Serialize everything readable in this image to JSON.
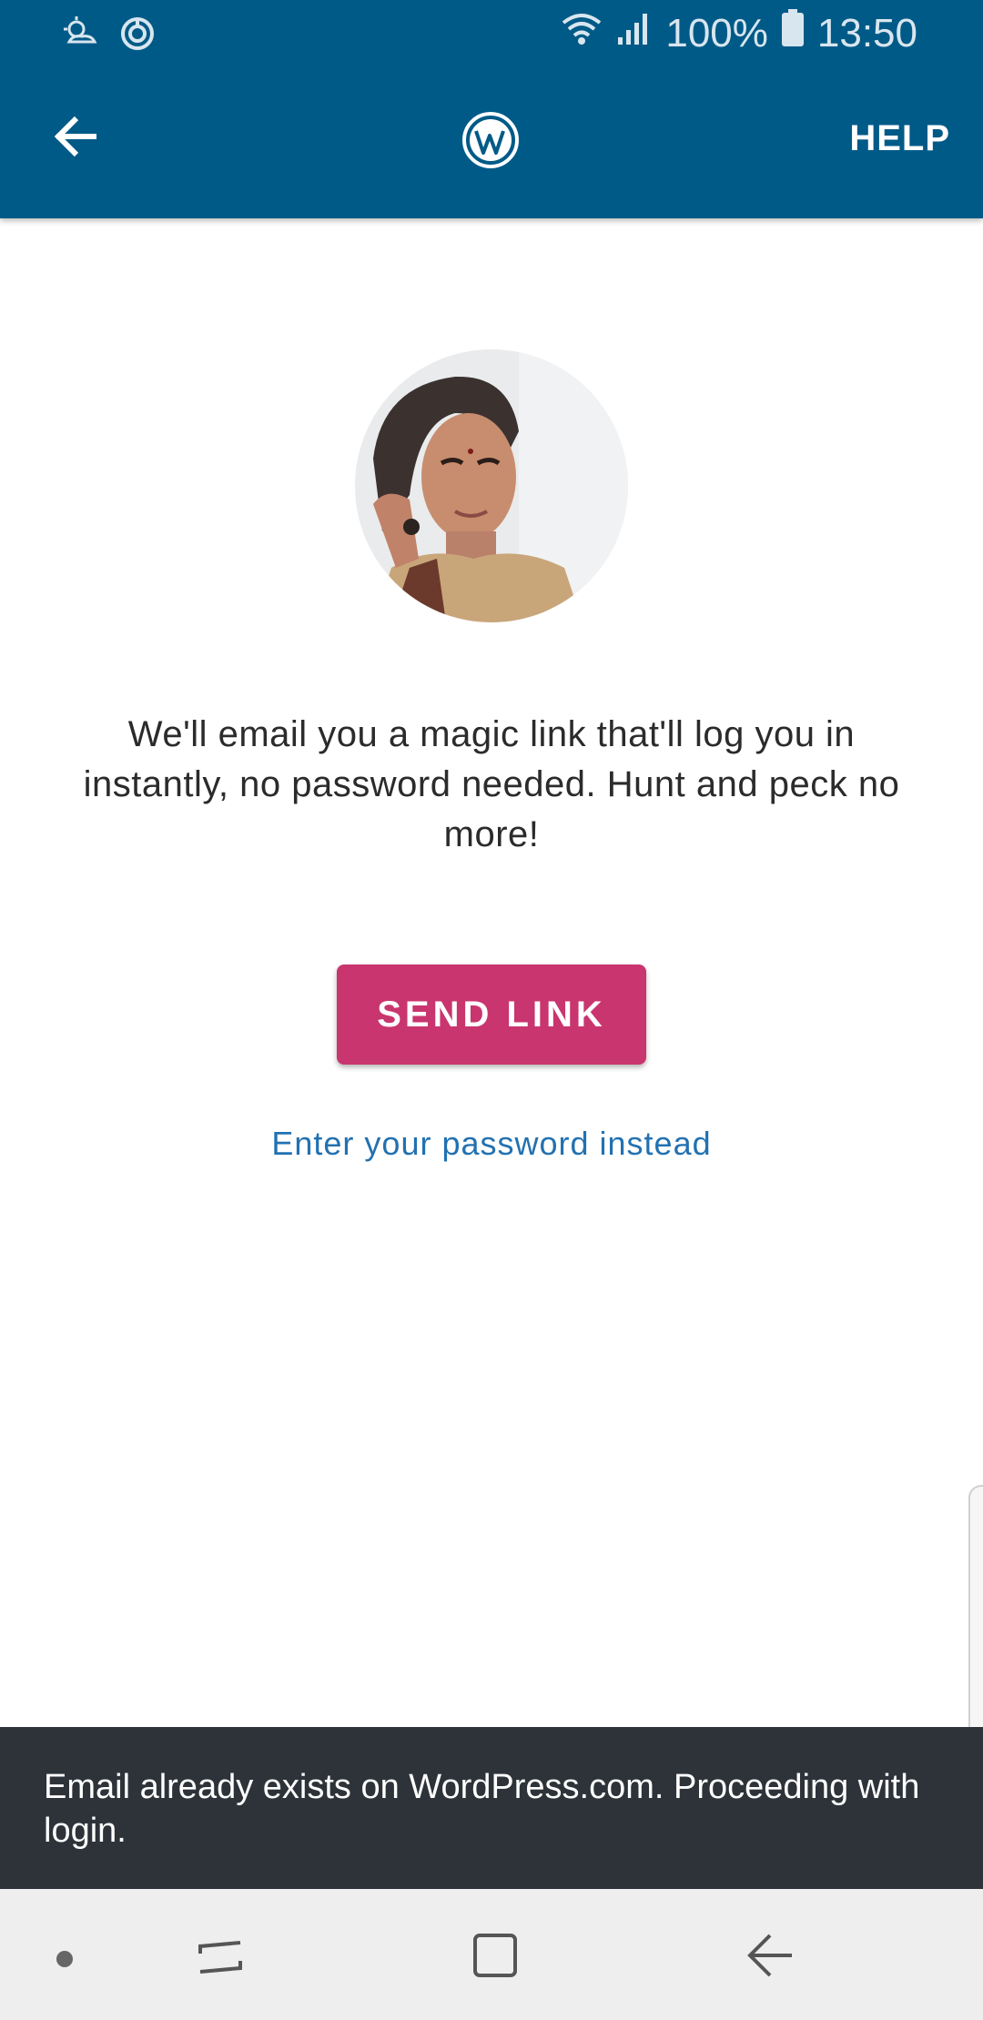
{
  "status_bar": {
    "battery": "100%",
    "time": "13:50",
    "icons": [
      "weather-icon",
      "sync-icon",
      "wifi-icon",
      "signal-icon",
      "battery-icon"
    ]
  },
  "app_bar": {
    "help_label": "HELP",
    "back_icon": "arrow-back-icon",
    "logo_icon": "wordpress-logo-icon",
    "color": "#005a87"
  },
  "main": {
    "message": "We'll email you a magic link that'll log you in instantly, no password needed. Hunt and peck no more!",
    "send_link_label": "SEND LINK",
    "password_link": "Enter your password instead",
    "accent_color": "#c9356e",
    "link_color": "#2271b1"
  },
  "snackbar": {
    "message": "Email already exists on WordPress.com. Proceeding with login."
  },
  "nav_bar": {
    "icons": [
      "nav-dot-icon",
      "recent-apps-icon",
      "home-icon",
      "back-icon"
    ]
  }
}
